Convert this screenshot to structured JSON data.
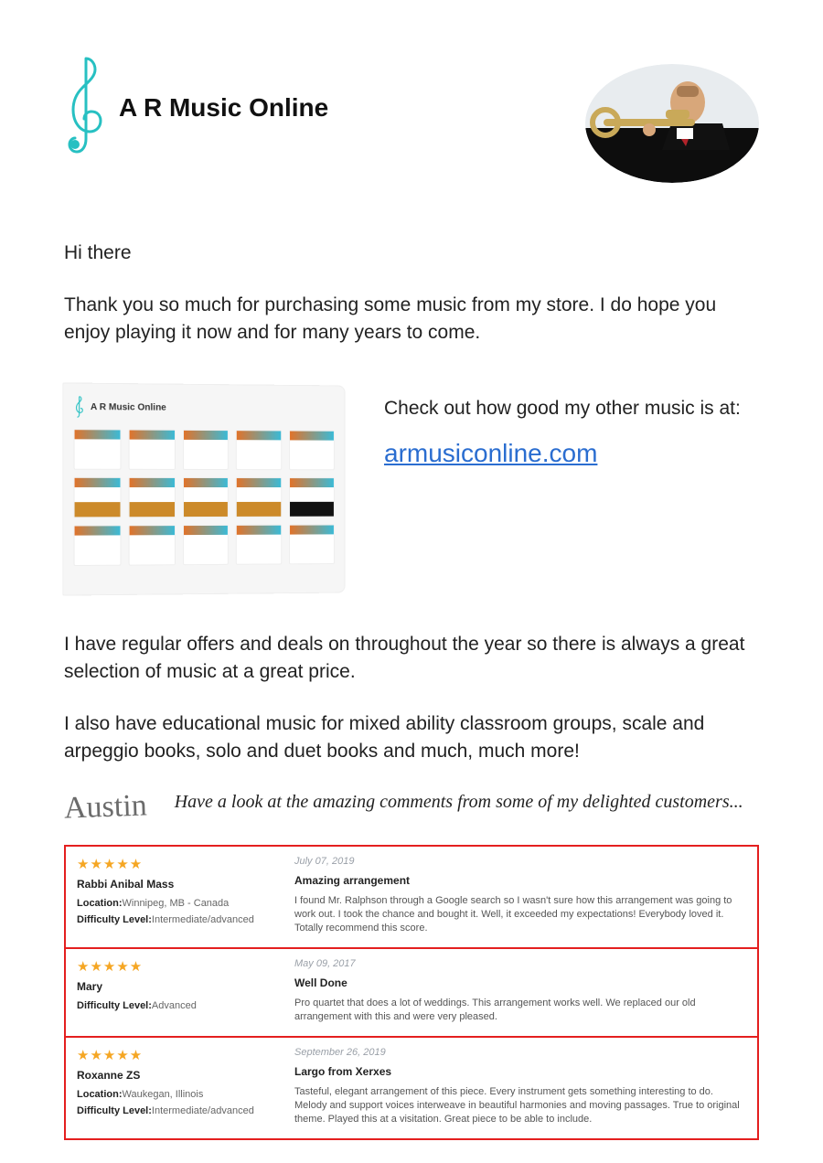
{
  "header": {
    "brand": "A R Music Online"
  },
  "greeting": "Hi there",
  "thanks": "Thank you so much for purchasing some music from my store. I do hope you enjoy playing it now and for many years to come.",
  "promo": {
    "lead": "Check out how good my other music is at:",
    "link": "armusiconline.com"
  },
  "paragraphs": {
    "deals": "I have regular offers and deals on throughout the year so there is always a great selection of music at a great price.",
    "edu": "I also have educational music for mixed ability classroom groups, scale and arpeggio books, solo and duet books and much, much more!"
  },
  "signature": "Austin",
  "handwritten": "Have a look at the amazing comments from some of my delighted customers...",
  "screenshot_brand": "A R Music Online",
  "reviews": [
    {
      "stars": "★★★★★",
      "name": "Rabbi Anibal Mass",
      "location": "Winnipeg, MB - Canada",
      "difficulty": "Intermediate/advanced",
      "date": "July 07, 2019",
      "title": "Amazing arrangement",
      "body": "I found Mr. Ralphson through a Google search so I wasn't sure how this arrangement was going to work out. I took the chance and bought it. Well, it exceeded my expectations! Everybody loved it. Totally recommend this score."
    },
    {
      "stars": "★★★★★",
      "name": "Mary",
      "location": "",
      "difficulty": "Advanced",
      "date": "May 09, 2017",
      "title": "Well Done",
      "body": "Pro quartet that does a lot of weddings. This arrangement works well. We replaced our old arrangement with this and were very pleased."
    },
    {
      "stars": "★★★★★",
      "name": "Roxanne ZS",
      "location": "Waukegan, Illinois",
      "difficulty": "Intermediate/advanced",
      "date": "September 26, 2019",
      "title": "Largo from Xerxes",
      "body": "Tasteful, elegant arrangement of this piece. Every instrument gets something interesting to do. Melody and support voices interweave in beautiful harmonies and moving passages. True to original theme. Played this at a visitation. Great piece to be able to include."
    }
  ],
  "labels": {
    "location": "Location:",
    "difficulty": "Difficulty Level:"
  }
}
